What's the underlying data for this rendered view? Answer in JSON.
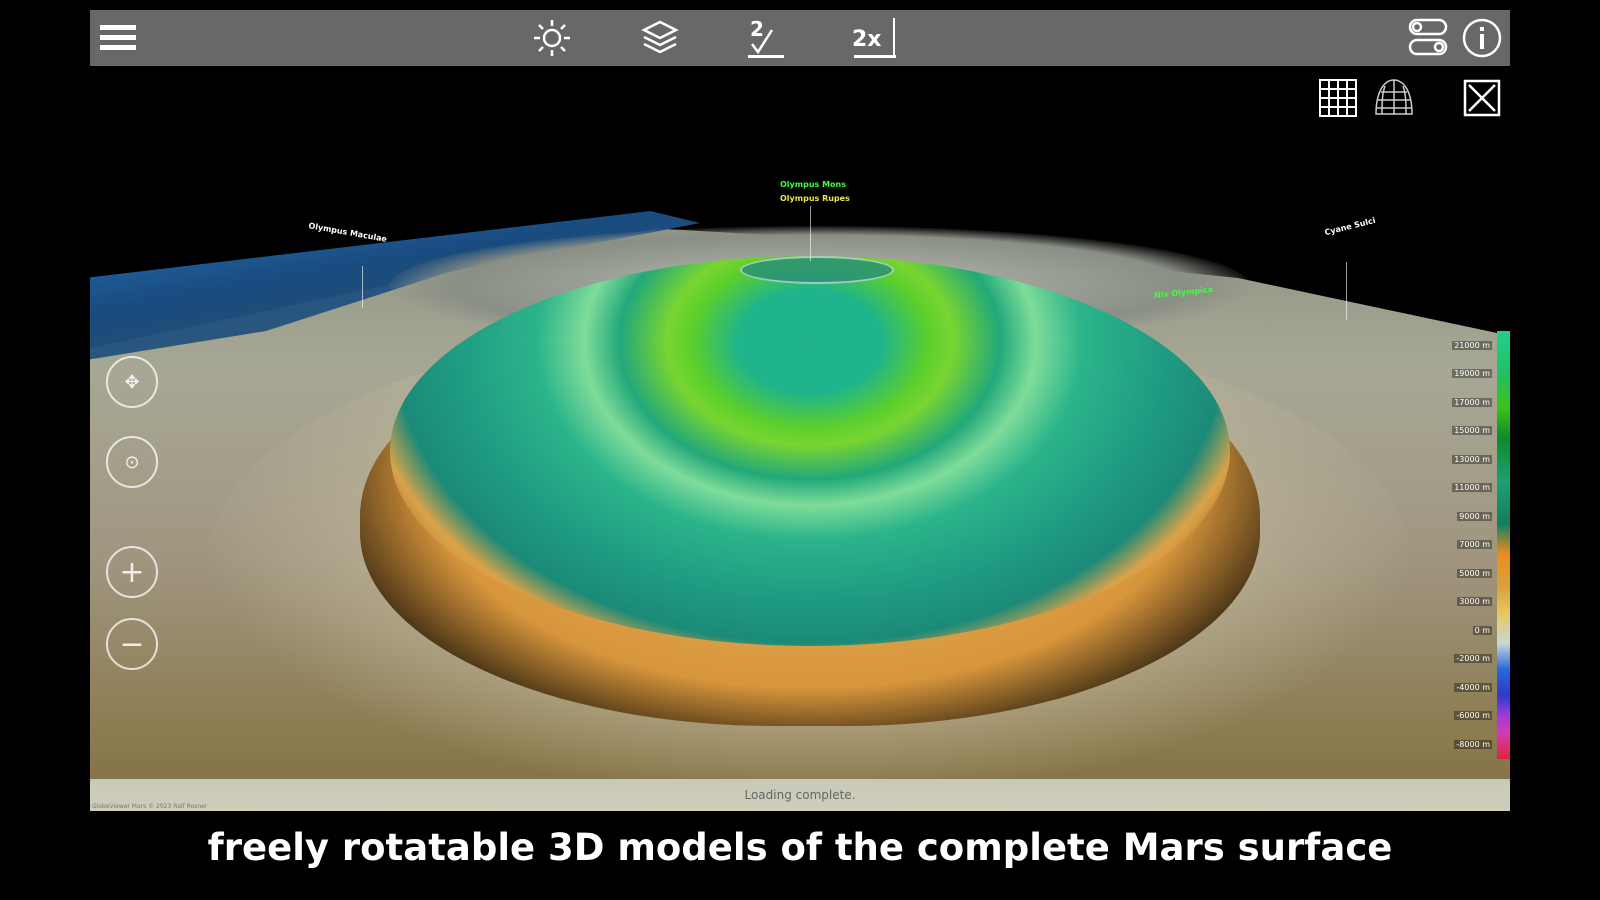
{
  "toolbar": {
    "menu_icon": "hamburger-menu-icon",
    "buttons": [
      {
        "icon": "sun-brightness-icon"
      },
      {
        "icon": "layers-icon"
      },
      {
        "icon": "exaggeration-check-icon",
        "label": "2"
      },
      {
        "icon": "vertical-scale-icon",
        "label": "2x"
      }
    ],
    "right_icons": [
      "toggle-settings-icon",
      "info-icon"
    ],
    "secondary_icons": [
      "grid-icon",
      "globe-wireframe-icon",
      "close-x-icon"
    ]
  },
  "map_labels": {
    "olympus_mons": "Olympus Mons",
    "olympus_rupes": "Olympus Rupes",
    "olympus_maculae": "Olympus Maculae",
    "cyane_sulci": "Cyane Sulci",
    "nix_olympica": "Nix Olympica"
  },
  "nav_controls": [
    "pan-icon",
    "rotate-icon",
    "zoom-in-icon",
    "zoom-out-icon"
  ],
  "legend": {
    "values": [
      "21000 m",
      "19000 m",
      "17000 m",
      "15000 m",
      "13000 m",
      "11000 m",
      "9000 m",
      "7000 m",
      "5000 m",
      "3000 m",
      "0 m",
      "-2000 m",
      "-4000 m",
      "-6000 m",
      "-8000 m"
    ]
  },
  "status": {
    "message": "Loading complete.",
    "copyright": "GlobeViewer Mars © 2023 Ralf Rosner"
  },
  "caption": "freely rotatable 3D models of the complete Mars surface",
  "colors": {
    "toolbar": "#686868",
    "label_green": "#3cff3c",
    "label_yellow": "#e8e84a"
  }
}
